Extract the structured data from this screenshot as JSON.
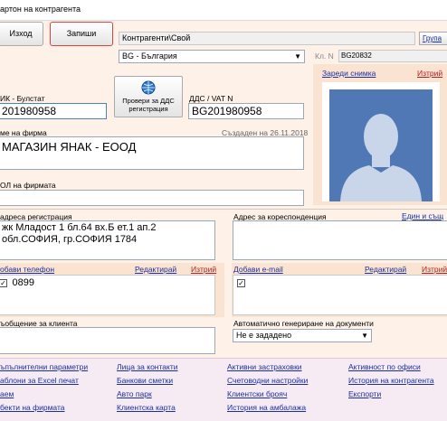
{
  "window": {
    "title": "артон на контрагента"
  },
  "toolbar": {
    "exit_label": "Изход",
    "save_label": "Запиши"
  },
  "group_path": "Контрагенти\\Свой",
  "group_button": "Група",
  "country": "BG - България",
  "client_no": {
    "label": "Кл. N",
    "value": "BG20832"
  },
  "photo": {
    "load_label": "Зареди снимка",
    "delete_label": "Изтрий"
  },
  "eik": {
    "label": "ИК - Булстат",
    "value": "201980958"
  },
  "vat_check": {
    "label": "Провери за ДДС регистрация"
  },
  "vat": {
    "label": "ДДС / VAT N",
    "value": "BG201980958"
  },
  "company": {
    "label": "ме на фирма",
    "created": "Създаден на 26.11.2018",
    "value": "МАГАЗИН ЯНАК - ЕООД"
  },
  "mol": {
    "label": "ОЛ на фирмата",
    "value": ""
  },
  "registration_address": {
    "label": "адреса регистрация",
    "line1": "жк Младост 1 бл.64 вх.Б ет.1 ап.2",
    "line2": "обл.СОФИЯ, гр.СОФИЯ 1784"
  },
  "correspondence_address": {
    "label": "Адрес за кореспонденция",
    "same_label": "Един и същ"
  },
  "phones": {
    "add_label": "обави телефон",
    "edit_label": "Редактирай",
    "delete_label": "Изтрий",
    "items": [
      "0899"
    ]
  },
  "emails": {
    "add_label": "Добави e-mail",
    "edit_label": "Редактирай",
    "delete_label": "Изтрий"
  },
  "client_message": {
    "label": "ъобщение за клиента"
  },
  "auto_docs": {
    "label": "Автоматично генериране на документи",
    "value": "Не е зададено"
  },
  "bottom_links": {
    "col1": [
      "ъпълнителни параметри",
      "аблони за Excel печат",
      "аем",
      "бекти на фирмата"
    ],
    "col2": [
      "Лица за контакти",
      "Банкови сметки",
      "Авто парк",
      "Клиентска карта"
    ],
    "col3": [
      "Активни застраховки",
      "Счетоводни настройки",
      "Клиентски брояч",
      "История на амбалажа"
    ],
    "col4": [
      "Активност по офиси",
      "История на контрагента",
      "Експорти"
    ]
  }
}
